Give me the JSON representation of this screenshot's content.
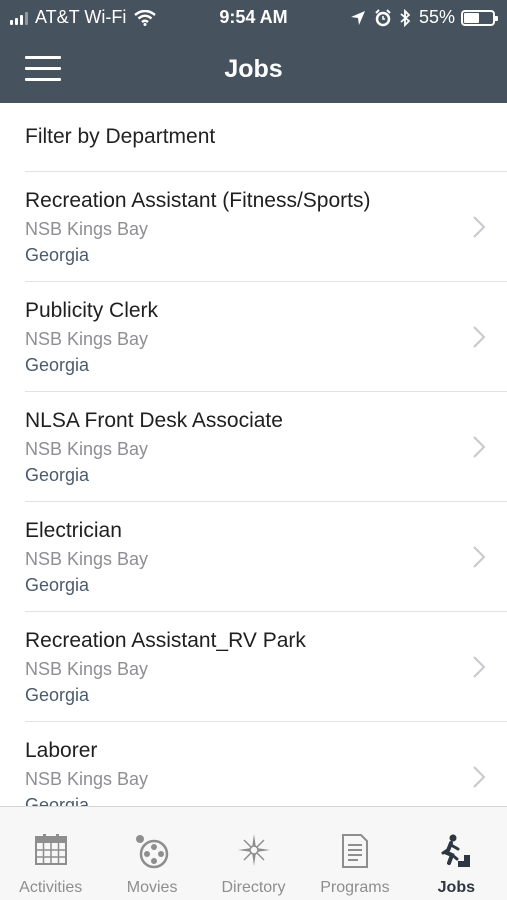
{
  "status_bar": {
    "carrier": "AT&T Wi-Fi",
    "time": "9:54 AM",
    "battery": "55%",
    "battery_level": 0.55
  },
  "nav": {
    "title": "Jobs",
    "menu_icon": "hamburger-menu-icon"
  },
  "filter": {
    "label": "Filter by Department"
  },
  "jobs": [
    {
      "title": "Recreation Assistant (Fitness/Sports)",
      "location": "NSB Kings Bay",
      "state": "Georgia"
    },
    {
      "title": "Publicity Clerk",
      "location": "NSB Kings Bay",
      "state": "Georgia"
    },
    {
      "title": "NLSA Front Desk Associate",
      "location": "NSB Kings Bay",
      "state": "Georgia"
    },
    {
      "title": "Electrician",
      "location": "NSB Kings Bay",
      "state": "Georgia"
    },
    {
      "title": "Recreation Assistant_RV Park",
      "location": "NSB Kings Bay",
      "state": "Georgia"
    },
    {
      "title": "Laborer",
      "location": "NSB Kings Bay",
      "state": "Georgia"
    }
  ],
  "tabs": [
    {
      "label": "Activities",
      "icon": "calendar-icon"
    },
    {
      "label": "Movies",
      "icon": "film-reel-icon"
    },
    {
      "label": "Directory",
      "icon": "compass-icon"
    },
    {
      "label": "Programs",
      "icon": "document-icon"
    },
    {
      "label": "Jobs",
      "icon": "climbing-stairs-icon",
      "active": true
    }
  ],
  "colors": {
    "header_bg": "#46535f",
    "state_text": "#4a5b6d",
    "active_tab": "#2d3742"
  }
}
